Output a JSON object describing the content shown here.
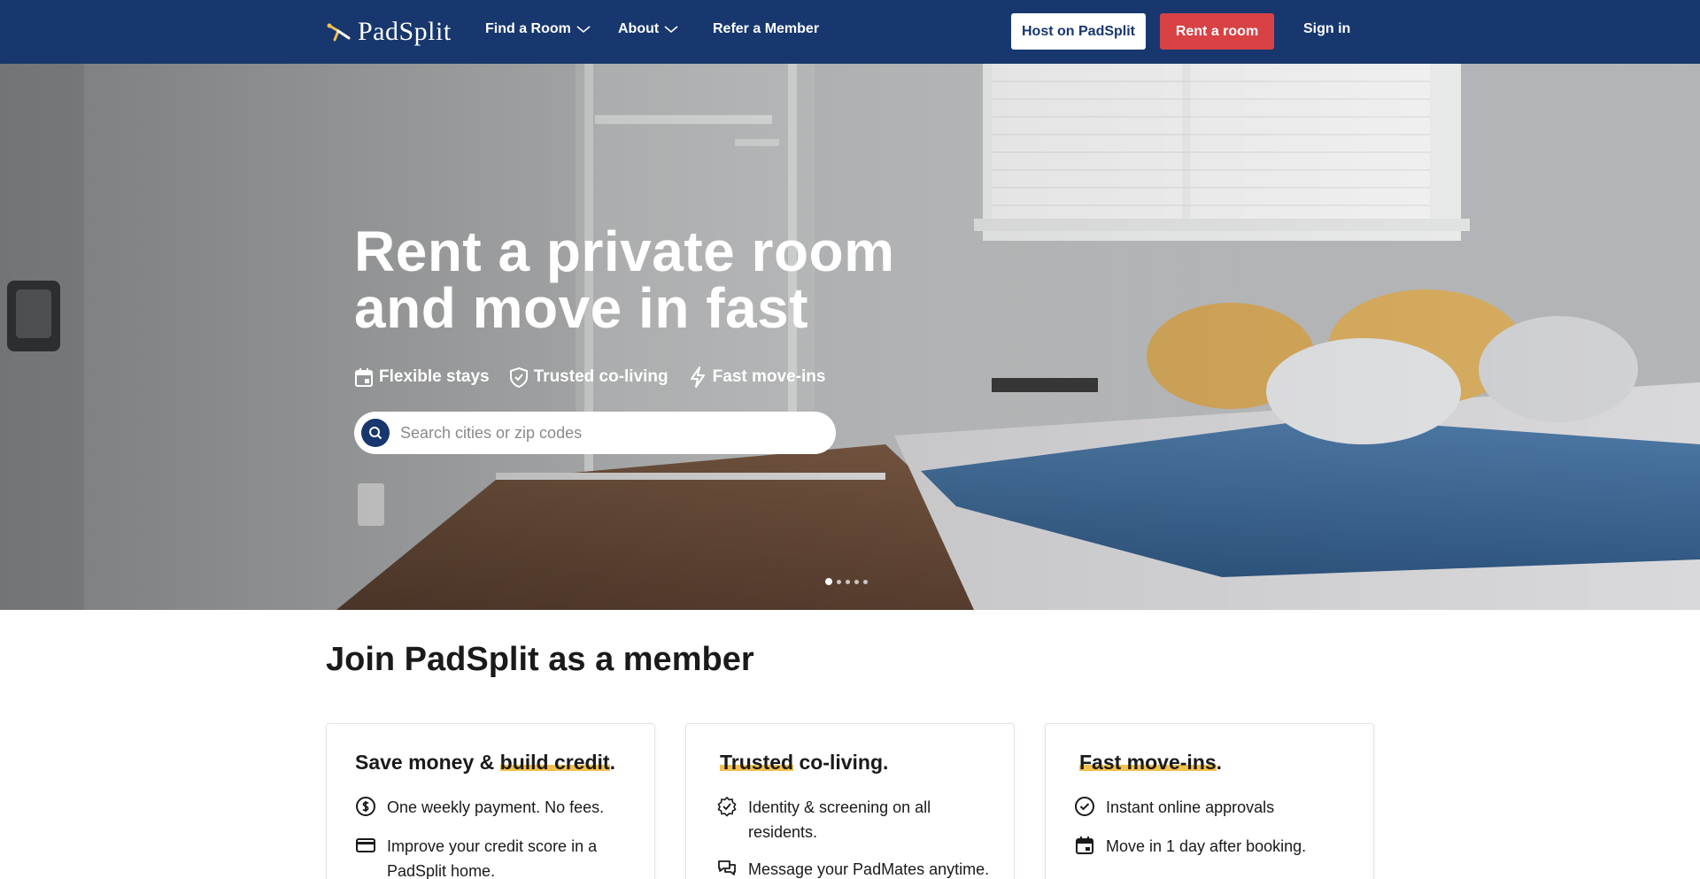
{
  "brand": {
    "name": "PadSplit",
    "accent": "#f2c14e",
    "navy": "#17376e",
    "red": "#d84245"
  },
  "nav": {
    "find_room": "Find a Room",
    "about": "About",
    "refer": "Refer a Member",
    "host_button": "Host on PadSplit",
    "rent_button": "Rent a room",
    "sign_in": "Sign in"
  },
  "hero": {
    "title": "Rent a private room and move in fast",
    "features": [
      {
        "icon": "calendar-icon",
        "label": "Flexible stays"
      },
      {
        "icon": "shield-check-icon",
        "label": "Trusted co-living"
      },
      {
        "icon": "lightning-icon",
        "label": "Fast move-ins"
      }
    ],
    "search": {
      "placeholder": "Search cities or zip codes",
      "value": ""
    },
    "carousel": {
      "slides": 5,
      "active": 1
    }
  },
  "member": {
    "title": "Join PadSplit as a member",
    "cards": [
      {
        "title_highlight_pre": "Save money & ",
        "title_highlight": "build credit",
        "title_post": ".",
        "items": [
          {
            "icon": "dollar-circle-icon",
            "text": "One weekly payment. No fees."
          },
          {
            "icon": "credit-card-icon",
            "text": "Improve your credit score in a PadSplit home."
          }
        ]
      },
      {
        "title_highlight_pre": "",
        "title_highlight": "Trusted",
        "title_post": " co-living.",
        "items": [
          {
            "icon": "verified-badge-icon",
            "text": "Identity & screening on all residents."
          },
          {
            "icon": "chat-bubbles-icon",
            "text": "Message your PadMates anytime."
          }
        ]
      },
      {
        "title_highlight_pre": "",
        "title_highlight": "Fast move-ins",
        "title_post": ".",
        "items": [
          {
            "icon": "check-circle-icon",
            "text": "Instant online approvals"
          },
          {
            "icon": "calendar-icon",
            "text": "Move in 1 day after booking."
          }
        ]
      }
    ]
  }
}
